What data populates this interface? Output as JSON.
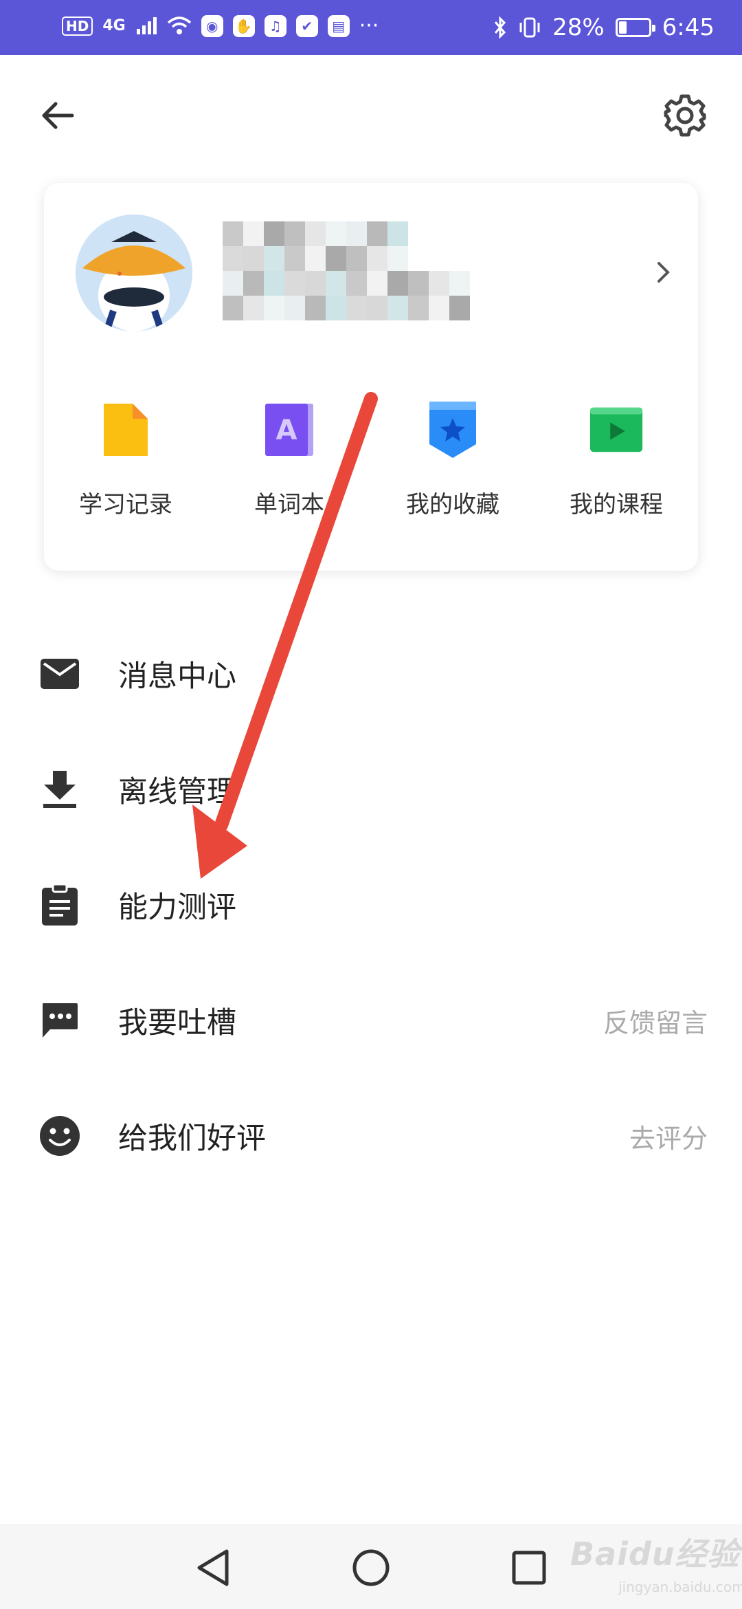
{
  "status_bar": {
    "hd_badge": "HD",
    "network": "4G",
    "battery_percent": "28%",
    "battery_level": 0.28,
    "time": "6:45",
    "more": "···"
  },
  "header": {
    "back_icon": "arrow-left-icon",
    "settings_icon": "gear-icon"
  },
  "profile": {
    "avatar_icon": "avatar-icon",
    "chevron_icon": "chevron-right-icon"
  },
  "shortcuts": [
    {
      "label": "学习记录",
      "icon": "document-icon",
      "color": "#fbbf12"
    },
    {
      "label": "单词本",
      "icon": "letter-a-book-icon",
      "color": "#7a4ff1"
    },
    {
      "label": "我的收藏",
      "icon": "star-bookmark-icon",
      "color": "#2a8cf7"
    },
    {
      "label": "我的课程",
      "icon": "play-video-icon",
      "color": "#1bb95b"
    }
  ],
  "menu": [
    {
      "label": "消息中心",
      "icon": "mail-icon",
      "hint": ""
    },
    {
      "label": "离线管理",
      "icon": "download-icon",
      "hint": ""
    },
    {
      "label": "能力测评",
      "icon": "clipboard-icon",
      "hint": ""
    },
    {
      "label": "我要吐槽",
      "icon": "chat-bubble-icon",
      "hint": "反馈留言"
    },
    {
      "label": "给我们好评",
      "icon": "smiley-icon",
      "hint": "去评分"
    }
  ],
  "nav_bar": {
    "back_icon": "triangle-back-icon",
    "home_icon": "circle-home-icon",
    "recents_icon": "square-recents-icon"
  },
  "watermark": {
    "brand": "Baidu经验",
    "url": "jingyan.baidu.com"
  },
  "colors": {
    "status_bar": "#5b55d8",
    "annotation_arrow": "#e8473a"
  }
}
